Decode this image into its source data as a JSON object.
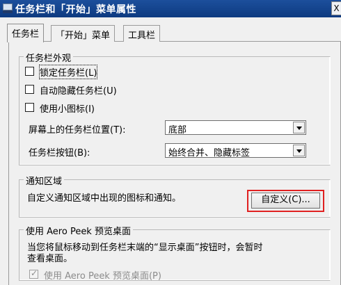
{
  "window": {
    "title": "任务栏和「开始」菜单属性",
    "close_glyph": "X"
  },
  "tabs": [
    {
      "label": "任务栏",
      "active": true
    },
    {
      "label": "「开始」菜单",
      "active": false
    },
    {
      "label": "工具栏",
      "active": false
    }
  ],
  "appearance": {
    "title": "任务栏外观",
    "lock_label": "锁定任务栏(L)",
    "autohide_label": "自动隐藏任务栏(U)",
    "small_icons_label": "使用小图标(I)",
    "location_label": "屏幕上的任务栏位置(T):",
    "location_value": "底部",
    "buttons_label": "任务栏按钮(B):",
    "buttons_value": "始终合并、隐藏标签"
  },
  "notification": {
    "title": "通知区域",
    "description": "自定义通知区域中出现的图标和通知。",
    "customize_button": "自定义(C)..."
  },
  "aero_peek": {
    "title": "使用 Aero Peek 预览桌面",
    "description_line1": "当您将鼠标移动到任务栏末端的“显示桌面”按钮时，会暂时",
    "description_line2": "查看桌面。",
    "checkbox_label": "使用 Aero Peek 预览桌面(P)"
  },
  "colors": {
    "titlebar": "#1c4f9c",
    "highlight": "#e02020"
  }
}
